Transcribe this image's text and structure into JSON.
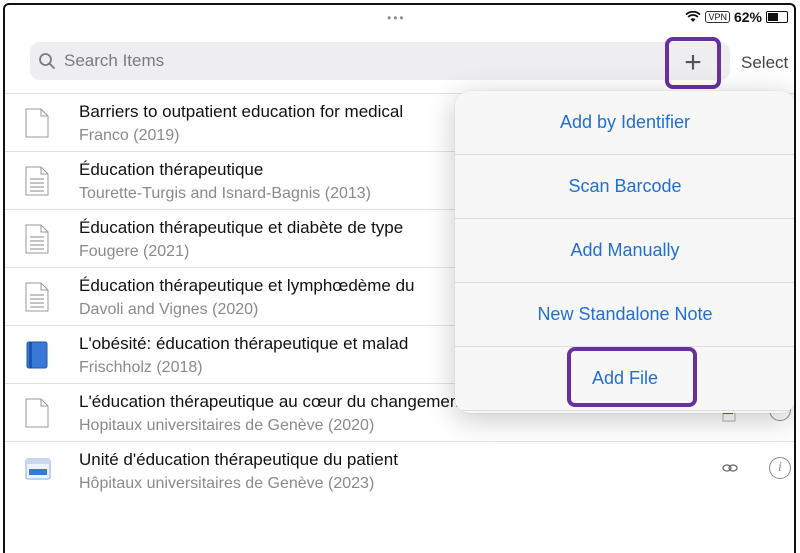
{
  "status": {
    "dots": "•••",
    "vpn": "VPN",
    "battery": "62%",
    "battery_level": 0.62
  },
  "search": {
    "placeholder": "Search Items"
  },
  "toolbar": {
    "add_label": "+",
    "select_label": "Select"
  },
  "items": [
    {
      "title": "Barriers to outpatient education for medical",
      "sub": "Franco (2019)",
      "icon": "document-icon"
    },
    {
      "title": "Éducation thérapeutique",
      "sub": "Tourette-Turgis and Isnard-Bagnis (2013)",
      "icon": "text-document-icon"
    },
    {
      "title": "Éducation thérapeutique et diabète de type",
      "sub": "Fougere (2021)",
      "icon": "text-document-icon"
    },
    {
      "title": "Éducation thérapeutique et lymphœdème du",
      "sub": "Davoli and Vignes (2020)",
      "icon": "text-document-icon"
    },
    {
      "title": "L'obésité: éducation thérapeutique et malad",
      "sub": "Frischholz (2018)",
      "icon": "book-icon"
    },
    {
      "title": "L'éducation thérapeutique au cœur du changement",
      "sub": "Hopitaux universitaires de Genève  (2020)",
      "icon": "document-icon"
    },
    {
      "title": "Unité d'éducation thérapeutique du patient",
      "sub": "Hôpitaux universitaires de Genève (2023)",
      "icon": "webpage-icon"
    }
  ],
  "menu": {
    "items": [
      "Add by Identifier",
      "Scan Barcode",
      "Add Manually",
      "New Standalone Note",
      "Add File"
    ]
  },
  "colors": {
    "accent": "#1f6fd6",
    "highlight": "#6a2f9e"
  }
}
